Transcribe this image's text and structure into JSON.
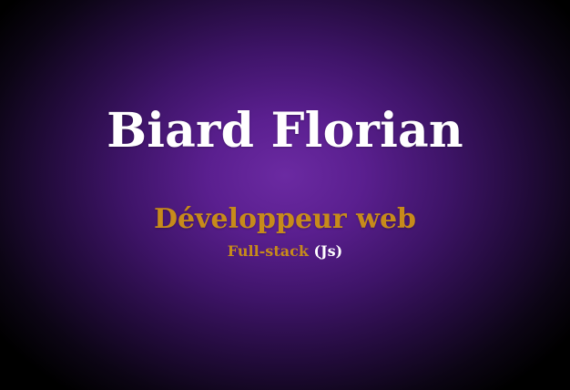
{
  "profile": {
    "name": "Biard Florian",
    "role": "Développeur web",
    "stack": {
      "label": "Full-stack",
      "qualifier": "(Js)"
    }
  },
  "colors": {
    "background_center": "#6b2aa2",
    "background_edge": "#000000",
    "name_text": "#ffffff",
    "accent_text": "#c78b1a"
  }
}
